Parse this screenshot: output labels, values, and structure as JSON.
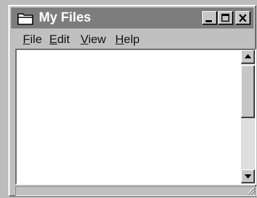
{
  "window": {
    "title": "My Files",
    "title_icon": "folder-icon",
    "controls": [
      "minimize-icon",
      "maximize-icon",
      "close-icon"
    ]
  },
  "menubar": {
    "items": [
      {
        "accel": "F",
        "rest": "ile"
      },
      {
        "accel": "E",
        "rest": "dit"
      },
      {
        "accel": "V",
        "rest": "iew"
      },
      {
        "accel": "H",
        "rest": "elp"
      }
    ]
  },
  "scrollbar": {
    "up_icon": "scroll-up-arrow-icon",
    "down_icon": "scroll-down-arrow-icon",
    "position": 0
  },
  "colors": {
    "titlebar": "#7d7d7d",
    "face": "#c0c0c0",
    "client": "#ffffff"
  }
}
